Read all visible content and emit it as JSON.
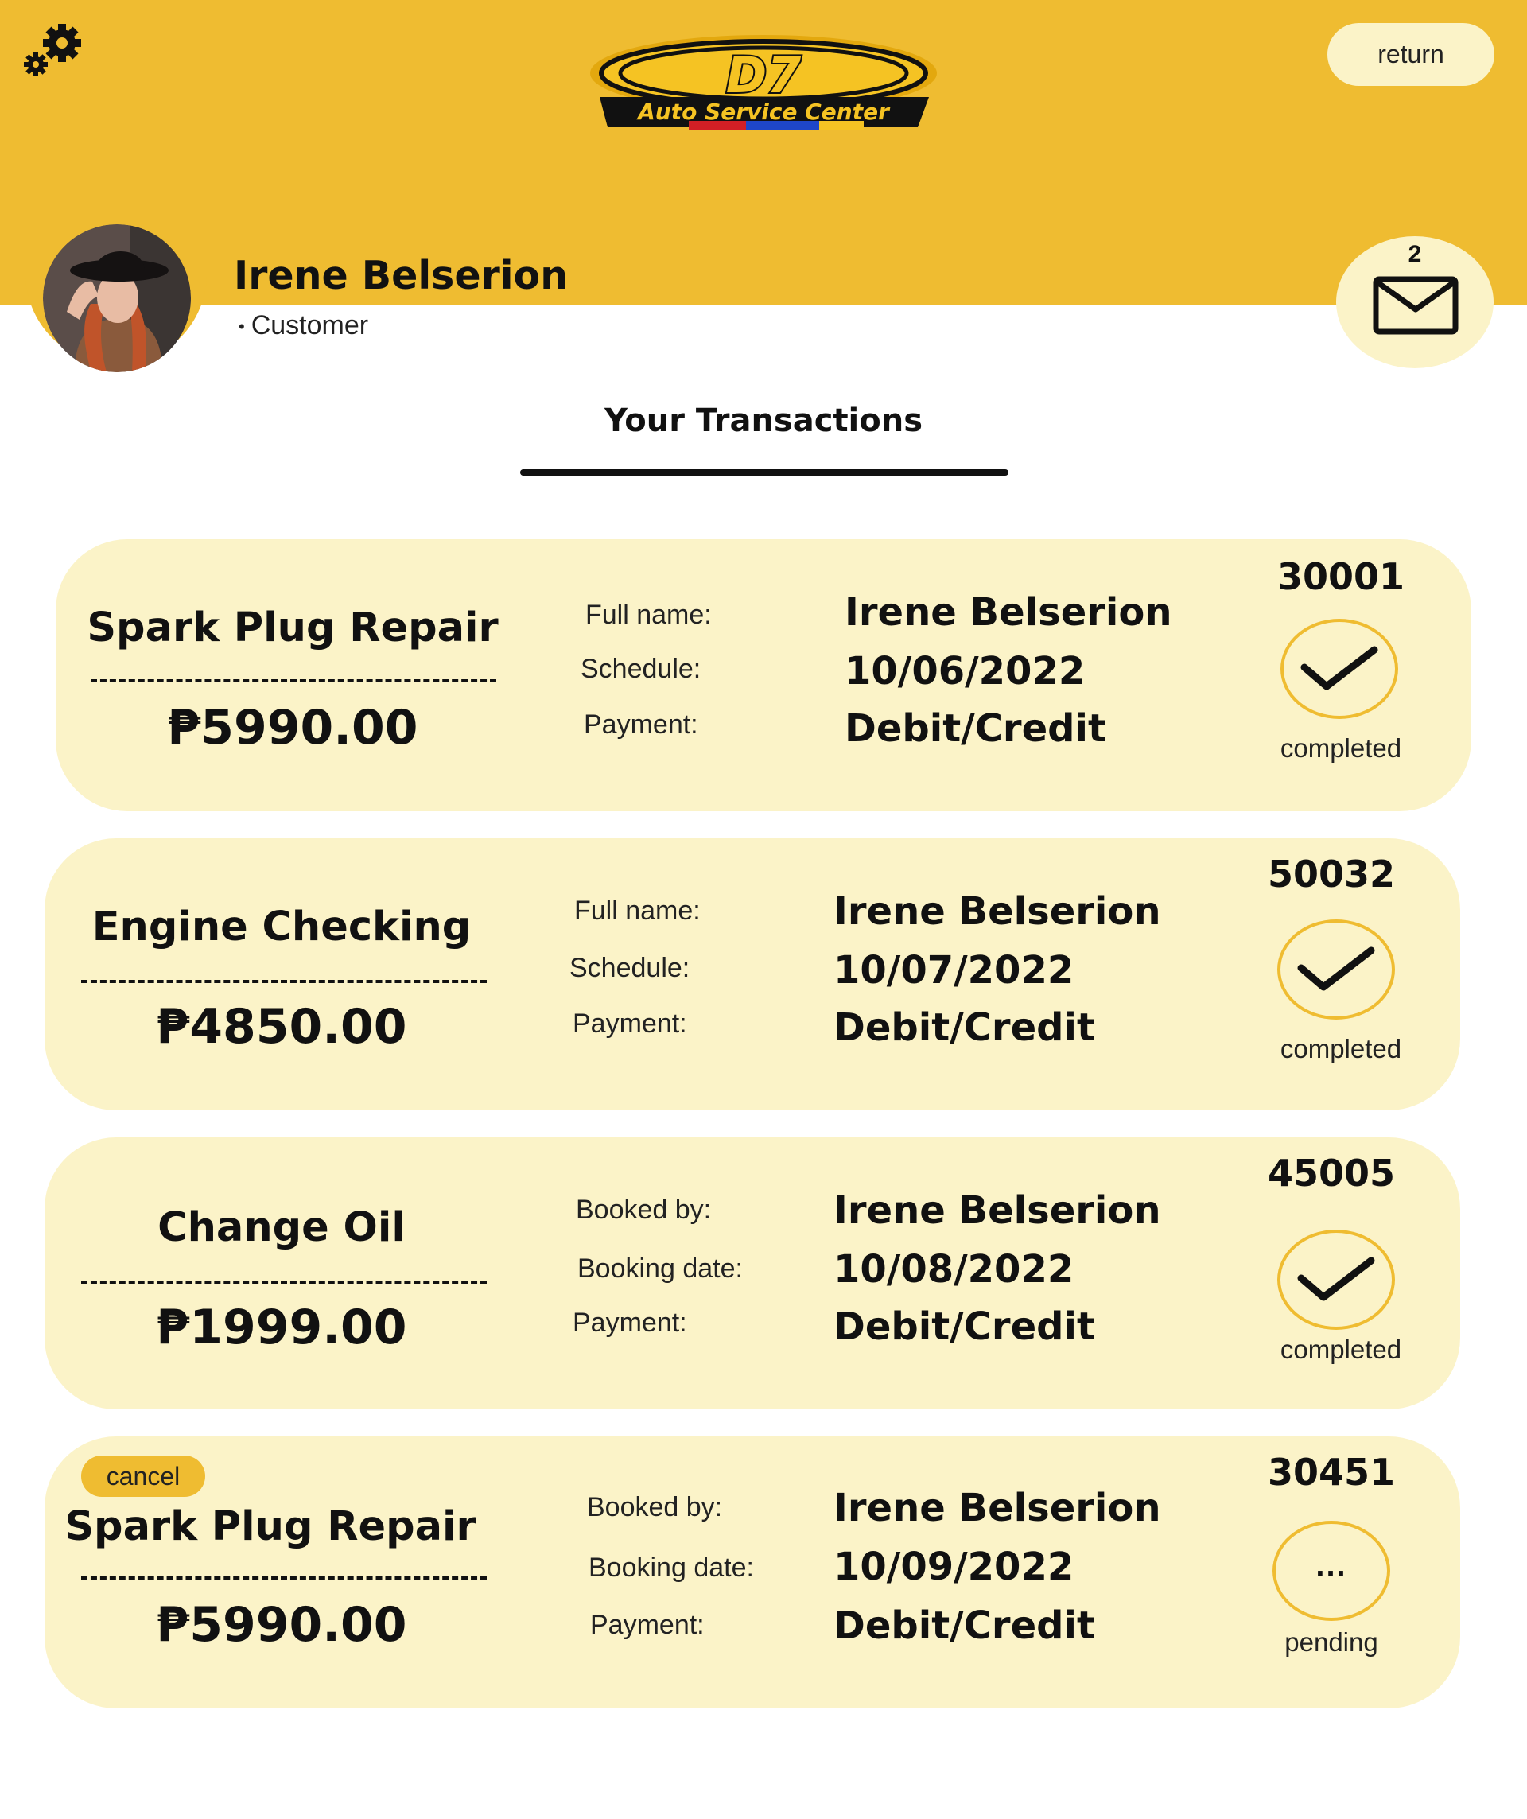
{
  "header": {
    "logo": {
      "title": "D7",
      "subtitle": "Auto Service Center"
    },
    "return_label": "return",
    "settings_icon": "gears-icon"
  },
  "profile": {
    "name": "Irene Belserion",
    "role": "Customer",
    "mail_icon": "envelope-icon",
    "mail_count": "2"
  },
  "section": {
    "title": "Your Transactions"
  },
  "colors": {
    "accent": "#EFBC31",
    "card_bg": "#FBF3C8",
    "text": "#111111"
  },
  "transactions": [
    {
      "service": "Spark Plug Repair",
      "price": "₱5990.00",
      "label_1": "Full name:",
      "value_1": "Irene Belserion",
      "label_2": "Schedule:",
      "value_2": "10/06/2022",
      "label_3": "Payment:",
      "value_3": "Debit/Credit",
      "id": "30001",
      "status": "completed",
      "status_icon": "check-icon"
    },
    {
      "service": "Engine Checking",
      "price": "₱4850.00",
      "label_1": "Full name:",
      "value_1": "Irene Belserion",
      "label_2": "Schedule:",
      "value_2": "10/07/2022",
      "label_3": "Payment:",
      "value_3": "Debit/Credit",
      "id": "50032",
      "status": "completed",
      "status_icon": "check-icon"
    },
    {
      "service": "Change Oil",
      "price": "₱1999.00",
      "label_1": "Booked by:",
      "value_1": "Irene Belserion",
      "label_2": "Booking date:",
      "value_2": "10/08/2022",
      "label_3": "Payment:",
      "value_3": "Debit/Credit",
      "id": "45005",
      "status": "completed",
      "status_icon": "check-icon"
    },
    {
      "cancel_label": "cancel",
      "service": "Spark Plug Repair",
      "price": "₱5990.00",
      "label_1": "Booked by:",
      "value_1": "Irene Belserion",
      "label_2": "Booking date:",
      "value_2": "10/09/2022",
      "label_3": "Payment:",
      "value_3": "Debit/Credit",
      "id": "30451",
      "status": "pending",
      "status_icon": "ellipsis-icon",
      "status_glyph": "..."
    }
  ]
}
